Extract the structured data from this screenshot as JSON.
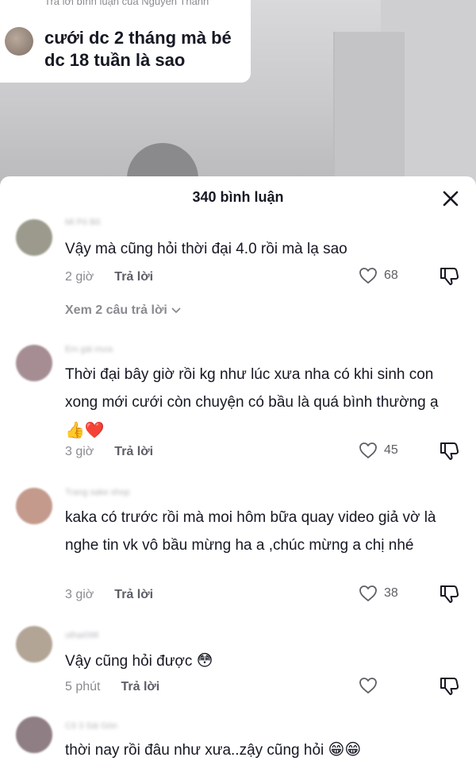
{
  "reply_card": {
    "meta": "Trả lời bình luận của Nguyễn Thanh",
    "text": "cưới dc 2 tháng mà bé dc 18 tuần là sao"
  },
  "sheet": {
    "title": "340 bình luận",
    "close_icon": "close-icon"
  },
  "reply_label": "Trả lời",
  "comments": [
    {
      "username": "Mi Pó Bô",
      "text": "Vậy mà cũng hỏi thời đại 4.0 rồi mà lạ sao",
      "time": "2 giờ",
      "likes": "68",
      "view_replies": "Xem 2 câu trả lời",
      "avatar_color": "#9b9a8c"
    },
    {
      "username": "Em gái mưa",
      "text": "Thời đại bây giờ rồi kg như lúc xưa nha có khi sinh con xong mới cưới còn chuyện có bầu là quá bình thường ạ",
      "emoji": "👍❤️",
      "time": "3 giờ",
      "likes": "45",
      "avatar_color": "#a58d93"
    },
    {
      "username": "Trang sake shop",
      "text": "kaka có trước rồi mà moi hôm bữa quay video giả vờ là nghe tin vk vô bầu mừng ha a ,chúc mừng a chị nhé",
      "time": "3 giờ",
      "likes": "38",
      "avatar_color": "#c49a8c"
    },
    {
      "username": "uthai098",
      "text": "Vậy cũng hỏi được",
      "emoji": "😳",
      "time": "5 phút",
      "likes": "",
      "avatar_color": "#b3a595"
    },
    {
      "username": "Cô 3 Sài Gòn",
      "text": "thời nay rồi đâu như xưa..zậy cũng hỏi",
      "emoji": "😁😁",
      "avatar_color": "#8f7e83"
    }
  ]
}
